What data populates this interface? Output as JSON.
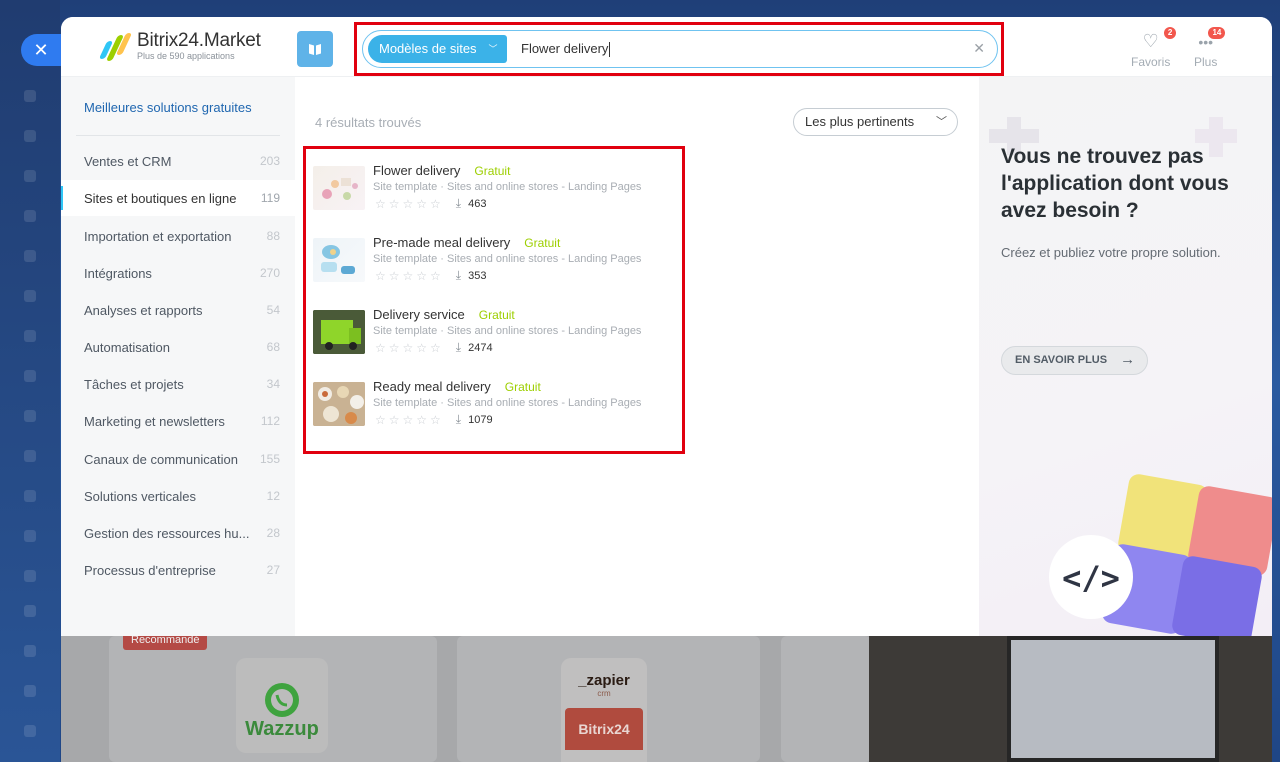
{
  "logo": {
    "title": "Bitrix24.Market",
    "subtitle": "Plus de 590 applications"
  },
  "search": {
    "category_chip": "Modèles de sites",
    "query": "Flower delivery"
  },
  "header_actions": [
    {
      "label": "Favoris",
      "count": "2",
      "icon": "heart-icon"
    },
    {
      "label": "Plus",
      "count": "14",
      "icon": "more-dots-icon"
    }
  ],
  "sidebar": {
    "top_link": "Meilleures solutions gratuites",
    "items": [
      {
        "label": "Ventes et CRM",
        "count": "203"
      },
      {
        "label": "Sites et boutiques en ligne",
        "count": "119"
      },
      {
        "label": "Importation et exportation",
        "count": "88"
      },
      {
        "label": "Intégrations",
        "count": "270"
      },
      {
        "label": "Analyses et rapports",
        "count": "54"
      },
      {
        "label": "Automatisation",
        "count": "68"
      },
      {
        "label": "Tâches et projets",
        "count": "34"
      },
      {
        "label": "Marketing et newsletters",
        "count": "112"
      },
      {
        "label": "Canaux de communication",
        "count": "155"
      },
      {
        "label": "Solutions verticales",
        "count": "12"
      },
      {
        "label": "Gestion des ressources hu...",
        "count": "28"
      },
      {
        "label": "Processus d'entreprise",
        "count": "27"
      }
    ]
  },
  "results": {
    "count_text": "4 résultats trouvés",
    "sort_label": "Les plus pertinents",
    "items": [
      {
        "title": "Flower delivery",
        "price": "Gratuit",
        "subtitle": "Site template · Sites and online stores - Landing Pages",
        "downloads": "463",
        "stars": "☆☆☆☆☆"
      },
      {
        "title": "Pre-made meal delivery",
        "price": "Gratuit",
        "subtitle": "Site template · Sites and online stores - Landing Pages",
        "downloads": "353",
        "stars": "☆☆☆☆☆"
      },
      {
        "title": "Delivery service",
        "price": "Gratuit",
        "subtitle": "Site template · Sites and online stores - Landing Pages",
        "downloads": "2474",
        "stars": "☆☆☆☆☆"
      },
      {
        "title": "Ready meal delivery",
        "price": "Gratuit",
        "subtitle": "Site template · Sites and online stores - Landing Pages",
        "downloads": "1079",
        "stars": "☆☆☆☆☆"
      }
    ]
  },
  "promo": {
    "title": "Vous ne trouvez pas l'application dont vous avez besoin ?",
    "subtitle": "Créez et publiez votre propre solution.",
    "button": "EN SAVOIR PLUS"
  },
  "background_cards": {
    "badge": "Recommandé",
    "wazzup": "Wazzup",
    "zapier": "_zapier",
    "zapier_sub": "crm",
    "bitrix": "Bitrix24"
  },
  "colors": {
    "accent": "#2fc6f6",
    "link": "#2067b0",
    "price": "#9dcf00",
    "highlight": "#e1000f",
    "chip": "#3bb2e8"
  }
}
